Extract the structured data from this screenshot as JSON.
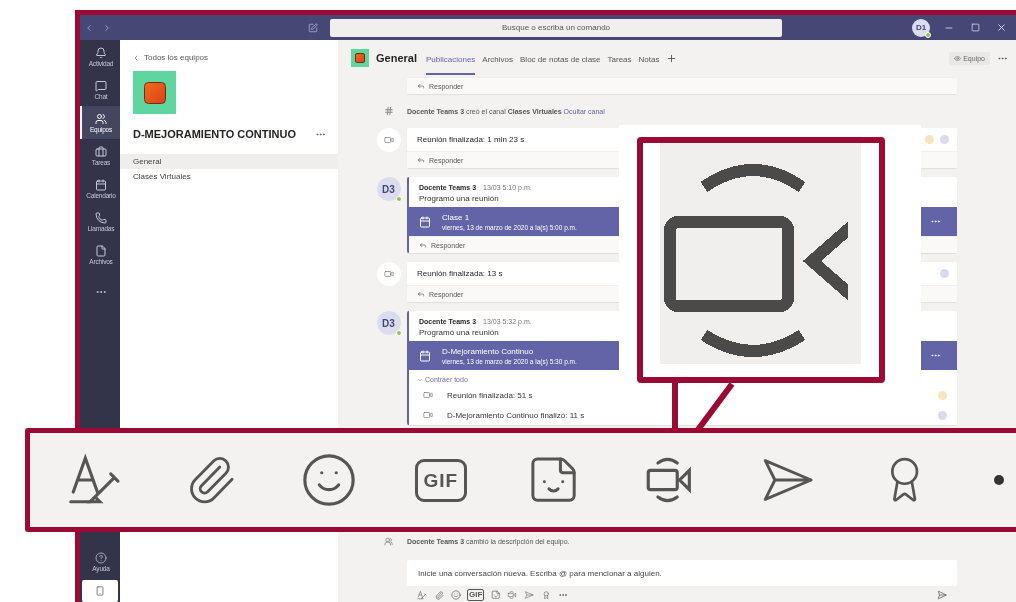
{
  "titlebar": {
    "search_placeholder": "Busque o escriba un comando",
    "avatar": "D1",
    "online": true
  },
  "rail": {
    "items": [
      {
        "kind": "activity",
        "label": "Actividad",
        "selected": false
      },
      {
        "kind": "chat",
        "label": "Chat",
        "selected": false
      },
      {
        "kind": "teams",
        "label": "Equipos",
        "selected": true
      },
      {
        "kind": "tasks",
        "label": "Tareas",
        "selected": false
      },
      {
        "kind": "calendar",
        "label": "Calendario",
        "selected": false
      },
      {
        "kind": "calls",
        "label": "Llamadas",
        "selected": false
      },
      {
        "kind": "files",
        "label": "Archivos",
        "selected": false
      },
      {
        "kind": "more"
      }
    ],
    "bottom": [
      {
        "kind": "help",
        "label": "Ayuda"
      },
      {
        "kind": "mobile"
      }
    ]
  },
  "team_panel": {
    "back_link": "Todos los equipos",
    "team_name": "D-MEJORAMIENTO CONTINUO",
    "channels": [
      {
        "name": "General",
        "selected": true
      },
      {
        "name": "Clases Virtuales",
        "selected": false
      }
    ]
  },
  "channel_header": {
    "name": "General",
    "tabs": [
      {
        "label": "Publicaciones",
        "selected": true
      },
      {
        "label": "Archivos",
        "selected": false
      },
      {
        "label": "Bloc de notas de clase",
        "selected": false
      },
      {
        "label": "Tareas",
        "selected": false
      },
      {
        "label": "Notas",
        "selected": false
      }
    ],
    "team_button": "Equipo"
  },
  "feed": [
    {
      "kind": "reply_stub",
      "reply": "Responder"
    },
    {
      "kind": "system",
      "text": "**Docente Teams 3** creó el canal **Clases Virtuales**",
      "link": "Ocultar canal"
    },
    {
      "kind": "meeting_ended",
      "title": "Reunión finalizada: 1 min 23 s",
      "participants": [
        {
          "color": "#f5e6bd"
        },
        {
          "color": "#d8d9ef"
        }
      ],
      "reply": "Responder"
    },
    {
      "kind": "post",
      "avatar": "D3",
      "online": true,
      "author": "Docente Teams 3",
      "time": "13/03 5:10 p.m.",
      "text": "Programó una reunión",
      "meeting": {
        "title": "Clase 1",
        "when": "viernes, 13 de marzo de 2020 a la(s) 5:00 p.m."
      },
      "reply": "Responder"
    },
    {
      "kind": "meeting_ended",
      "title": "Reunión finalizada: 13 s",
      "participants": [
        {
          "color": "#d8d9ef"
        }
      ],
      "reply": "Responder"
    },
    {
      "kind": "post",
      "avatar": "D3",
      "online": true,
      "author": "Docente Teams 3",
      "time": "13/03 5:32 p.m.",
      "text": "Programó una reunión",
      "meeting": {
        "title": "D-Mejoramiento Continuo",
        "when": "viernes, 13 de marzo de 2020 a la(s) 5:30 p.m."
      },
      "collapse": "Contraer todo",
      "thread": [
        {
          "text": "Reunión finalizada: 51 s",
          "color": "#f5e6bd"
        },
        {
          "text": "D-Mejoramiento Continuo finalizó: 11 s",
          "color": "#d8d9ef"
        }
      ]
    }
  ],
  "bottom": {
    "system": "**Docente Teams 3** cambió la descripción del equipo.",
    "compose_placeholder": "Inicie una conversación nueva. Escriba @ para mencionar a alguien.",
    "toolbar": [
      {
        "kind": "format"
      },
      {
        "kind": "attach"
      },
      {
        "kind": "emoji"
      },
      {
        "kind": "gif",
        "label": "GIF"
      },
      {
        "kind": "sticker"
      },
      {
        "kind": "meet"
      },
      {
        "kind": "stream"
      },
      {
        "kind": "praise"
      },
      {
        "kind": "more"
      }
    ]
  },
  "zoom_strip": {
    "tools": [
      {
        "kind": "format"
      },
      {
        "kind": "attach"
      },
      {
        "kind": "emoji"
      },
      {
        "kind": "gif",
        "label": "GIF"
      },
      {
        "kind": "sticker"
      },
      {
        "kind": "meet"
      },
      {
        "kind": "stream"
      },
      {
        "kind": "praise"
      },
      {
        "kind": "more"
      }
    ]
  },
  "callout": {
    "kind": "meet"
  }
}
